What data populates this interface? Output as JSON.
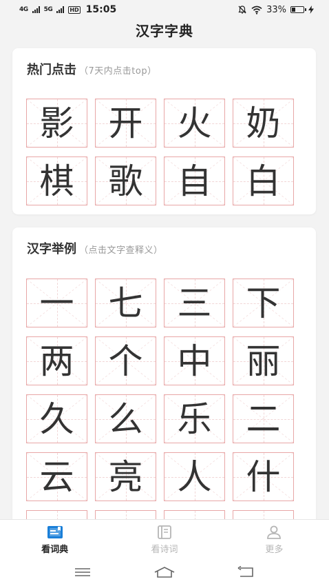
{
  "status": {
    "network1": "4G",
    "network2": "5G",
    "hd": "HD",
    "time": "15:05",
    "battery": "33%",
    "battery_level": 0.33
  },
  "header": {
    "title": "汉字字典"
  },
  "hot": {
    "title": "热门点击",
    "subtitle": "（7天内点击top）",
    "chars": [
      "影",
      "开",
      "火",
      "奶",
      "棋",
      "歌",
      "自",
      "白"
    ]
  },
  "examples": {
    "title": "汉字举例",
    "subtitle": "（点击文字查释义）",
    "chars": [
      "一",
      "七",
      "三",
      "下",
      "两",
      "个",
      "中",
      "丽",
      "久",
      "么",
      "乐",
      "二",
      "云",
      "亮",
      "人",
      "什"
    ]
  },
  "nav": {
    "items": [
      {
        "label": "看词典",
        "icon": "dictionary-icon",
        "active": true
      },
      {
        "label": "看诗词",
        "icon": "book-icon",
        "active": false
      },
      {
        "label": "更多",
        "icon": "user-icon",
        "active": false
      }
    ],
    "active_color": "#1a7fd8"
  }
}
